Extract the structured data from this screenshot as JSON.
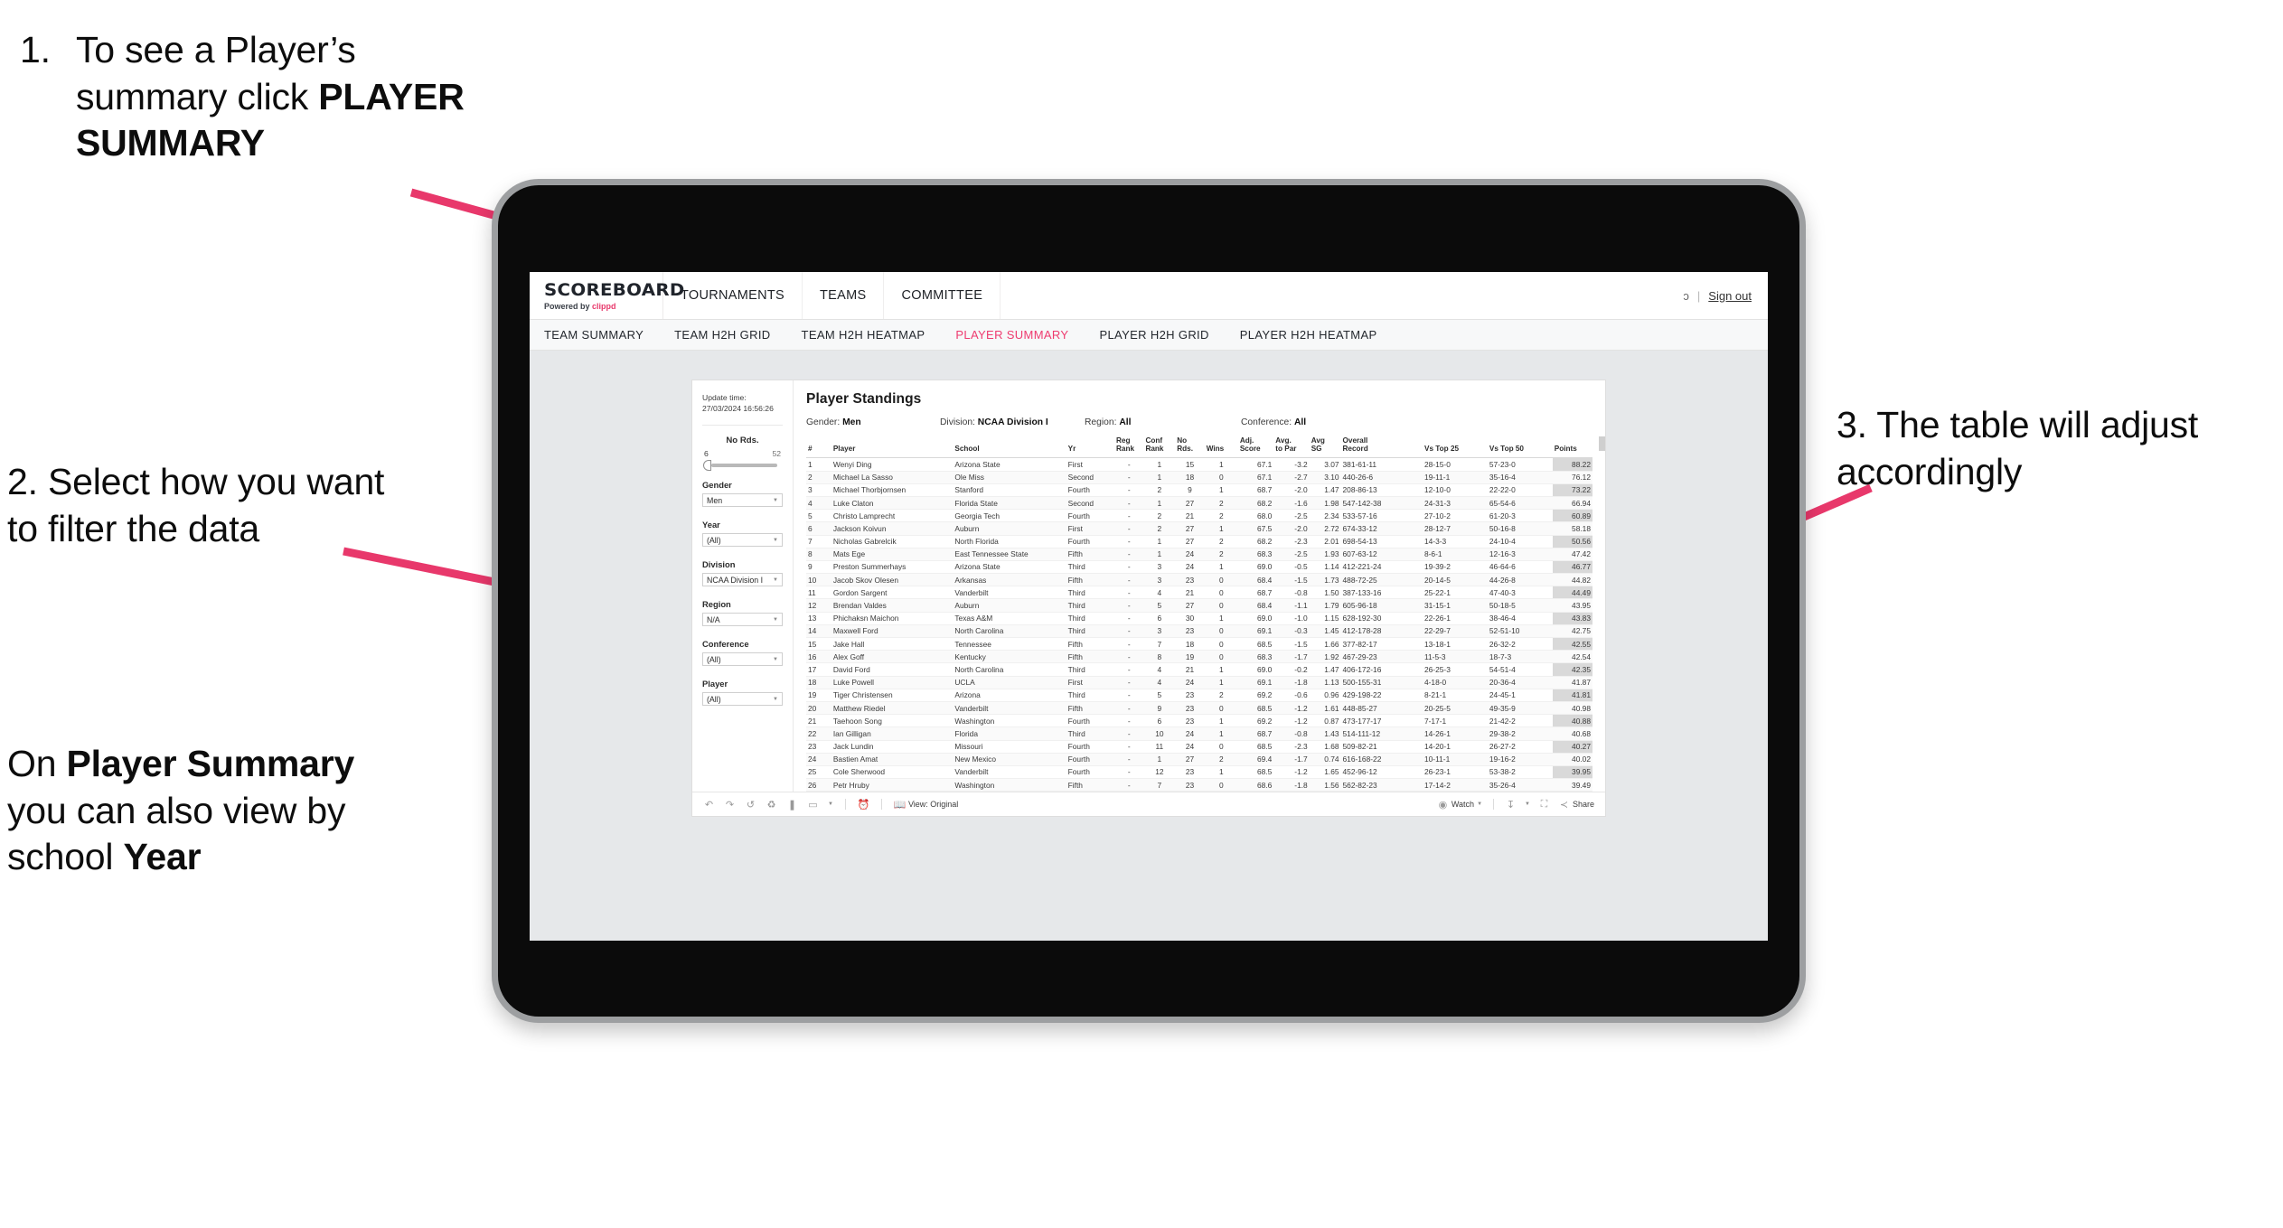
{
  "annotations": {
    "step1_number": "1.",
    "step1_text_a": "To see a Player’s summary click ",
    "step1_bold": "PLAYER SUMMARY",
    "step2": "2. Select how you want to filter the data",
    "step2b_pre": "On ",
    "step2b_bold1": "Player Summary",
    "step2b_mid": " you can also view by school ",
    "step2b_bold2": "Year",
    "step3": "3. The table will adjust accordingly",
    "arrow_color": "#e8386b"
  },
  "app": {
    "brand": {
      "name": "SCOREBOARD",
      "powered_prefix": "Powered by ",
      "powered_brand": "clippd"
    },
    "top_nav": [
      {
        "label": "TOURNAMENTS"
      },
      {
        "label": "TEAMS"
      },
      {
        "label": "COMMITTEE"
      }
    ],
    "top_right": {
      "account": "ɔ",
      "separator": "|",
      "sign_out": "Sign out"
    },
    "sub_nav": [
      {
        "label": "TEAM SUMMARY",
        "active": false
      },
      {
        "label": "TEAM H2H GRID",
        "active": false
      },
      {
        "label": "TEAM H2H HEATMAP",
        "active": false
      },
      {
        "label": "PLAYER SUMMARY",
        "active": true
      },
      {
        "label": "PLAYER H2H GRID",
        "active": false
      },
      {
        "label": "PLAYER H2H HEATMAP",
        "active": false
      }
    ],
    "accent_color": "#ee3b70"
  },
  "filters": {
    "update_time_label": "Update time:",
    "update_time_value": "27/03/2024 16:56:26",
    "slider": {
      "label": "No Rds.",
      "min": "6",
      "max": "52",
      "value": 6
    },
    "selects": [
      {
        "label": "Gender",
        "value": "Men"
      },
      {
        "label": "Year",
        "value": "(All)"
      },
      {
        "label": "Division",
        "value": "NCAA Division I"
      },
      {
        "label": "Region",
        "value": "N/A"
      },
      {
        "label": "Conference",
        "value": "(All)"
      },
      {
        "label": "Player",
        "value": "(All)"
      }
    ]
  },
  "viz": {
    "title": "Player Standings",
    "meta": [
      {
        "label": "Gender:",
        "value": "Men"
      },
      {
        "label": "Division:",
        "value": "NCAA Division I"
      },
      {
        "label": "Region:",
        "value": "All"
      },
      {
        "label": "Conference:",
        "value": "All"
      }
    ],
    "columns": [
      {
        "key": "rank",
        "l1": "#",
        "l2": ""
      },
      {
        "key": "player",
        "l1": "Player",
        "l2": ""
      },
      {
        "key": "school",
        "l1": "School",
        "l2": ""
      },
      {
        "key": "yr",
        "l1": "Yr",
        "l2": ""
      },
      {
        "key": "reg_rank",
        "l1": "Reg",
        "l2": "Rank"
      },
      {
        "key": "conf_rank",
        "l1": "Conf",
        "l2": "Rank"
      },
      {
        "key": "no_rds",
        "l1": "No",
        "l2": "Rds."
      },
      {
        "key": "wins",
        "l1": "Wins",
        "l2": ""
      },
      {
        "key": "adj_score",
        "l1": "Adj.",
        "l2": "Score"
      },
      {
        "key": "avg_to_par",
        "l1": "Avg.",
        "l2": "to Par"
      },
      {
        "key": "avg_sg",
        "l1": "Avg",
        "l2": "SG"
      },
      {
        "key": "overall_record",
        "l1": "Overall",
        "l2": "Record"
      },
      {
        "key": "vs_top25",
        "l1": "Vs Top 25",
        "l2": ""
      },
      {
        "key": "vs_top50",
        "l1": "Vs Top 50",
        "l2": ""
      },
      {
        "key": "points",
        "l1": "Points",
        "l2": ""
      }
    ],
    "rows": [
      {
        "rank": "1",
        "player": "Wenyi Ding",
        "school": "Arizona State",
        "yr": "First",
        "reg_rank": "-",
        "conf_rank": "1",
        "no_rds": "15",
        "wins": "1",
        "adj_score": "67.1",
        "avg_to_par": "-3.2",
        "avg_sg": "3.07",
        "overall_record": "381-61-11",
        "vs_top25": "28-15-0",
        "vs_top50": "57-23-0",
        "points": "88.22"
      },
      {
        "rank": "2",
        "player": "Michael La Sasso",
        "school": "Ole Miss",
        "yr": "Second",
        "reg_rank": "-",
        "conf_rank": "1",
        "no_rds": "18",
        "wins": "0",
        "adj_score": "67.1",
        "avg_to_par": "-2.7",
        "avg_sg": "3.10",
        "overall_record": "440-26-6",
        "vs_top25": "19-11-1",
        "vs_top50": "35-16-4",
        "points": "76.12"
      },
      {
        "rank": "3",
        "player": "Michael Thorbjornsen",
        "school": "Stanford",
        "yr": "Fourth",
        "reg_rank": "-",
        "conf_rank": "2",
        "no_rds": "9",
        "wins": "1",
        "adj_score": "68.7",
        "avg_to_par": "-2.0",
        "avg_sg": "1.47",
        "overall_record": "208-86-13",
        "vs_top25": "12-10-0",
        "vs_top50": "22-22-0",
        "points": "73.22"
      },
      {
        "rank": "4",
        "player": "Luke Claton",
        "school": "Florida State",
        "yr": "Second",
        "reg_rank": "-",
        "conf_rank": "1",
        "no_rds": "27",
        "wins": "2",
        "adj_score": "68.2",
        "avg_to_par": "-1.6",
        "avg_sg": "1.98",
        "overall_record": "547-142-38",
        "vs_top25": "24-31-3",
        "vs_top50": "65-54-6",
        "points": "66.94"
      },
      {
        "rank": "5",
        "player": "Christo Lamprecht",
        "school": "Georgia Tech",
        "yr": "Fourth",
        "reg_rank": "-",
        "conf_rank": "2",
        "no_rds": "21",
        "wins": "2",
        "adj_score": "68.0",
        "avg_to_par": "-2.5",
        "avg_sg": "2.34",
        "overall_record": "533-57-16",
        "vs_top25": "27-10-2",
        "vs_top50": "61-20-3",
        "points": "60.89"
      },
      {
        "rank": "6",
        "player": "Jackson Koivun",
        "school": "Auburn",
        "yr": "First",
        "reg_rank": "-",
        "conf_rank": "2",
        "no_rds": "27",
        "wins": "1",
        "adj_score": "67.5",
        "avg_to_par": "-2.0",
        "avg_sg": "2.72",
        "overall_record": "674-33-12",
        "vs_top25": "28-12-7",
        "vs_top50": "50-16-8",
        "points": "58.18"
      },
      {
        "rank": "7",
        "player": "Nicholas Gabrelcik",
        "school": "North Florida",
        "yr": "Fourth",
        "reg_rank": "-",
        "conf_rank": "1",
        "no_rds": "27",
        "wins": "2",
        "adj_score": "68.2",
        "avg_to_par": "-2.3",
        "avg_sg": "2.01",
        "overall_record": "698-54-13",
        "vs_top25": "14-3-3",
        "vs_top50": "24-10-4",
        "points": "50.56"
      },
      {
        "rank": "8",
        "player": "Mats Ege",
        "school": "East Tennessee State",
        "yr": "Fifth",
        "reg_rank": "-",
        "conf_rank": "1",
        "no_rds": "24",
        "wins": "2",
        "adj_score": "68.3",
        "avg_to_par": "-2.5",
        "avg_sg": "1.93",
        "overall_record": "607-63-12",
        "vs_top25": "8-6-1",
        "vs_top50": "12-16-3",
        "points": "47.42"
      },
      {
        "rank": "9",
        "player": "Preston Summerhays",
        "school": "Arizona State",
        "yr": "Third",
        "reg_rank": "-",
        "conf_rank": "3",
        "no_rds": "24",
        "wins": "1",
        "adj_score": "69.0",
        "avg_to_par": "-0.5",
        "avg_sg": "1.14",
        "overall_record": "412-221-24",
        "vs_top25": "19-39-2",
        "vs_top50": "46-64-6",
        "points": "46.77"
      },
      {
        "rank": "10",
        "player": "Jacob Skov Olesen",
        "school": "Arkansas",
        "yr": "Fifth",
        "reg_rank": "-",
        "conf_rank": "3",
        "no_rds": "23",
        "wins": "0",
        "adj_score": "68.4",
        "avg_to_par": "-1.5",
        "avg_sg": "1.73",
        "overall_record": "488-72-25",
        "vs_top25": "20-14-5",
        "vs_top50": "44-26-8",
        "points": "44.82"
      },
      {
        "rank": "11",
        "player": "Gordon Sargent",
        "school": "Vanderbilt",
        "yr": "Third",
        "reg_rank": "-",
        "conf_rank": "4",
        "no_rds": "21",
        "wins": "0",
        "adj_score": "68.7",
        "avg_to_par": "-0.8",
        "avg_sg": "1.50",
        "overall_record": "387-133-16",
        "vs_top25": "25-22-1",
        "vs_top50": "47-40-3",
        "points": "44.49"
      },
      {
        "rank": "12",
        "player": "Brendan Valdes",
        "school": "Auburn",
        "yr": "Third",
        "reg_rank": "-",
        "conf_rank": "5",
        "no_rds": "27",
        "wins": "0",
        "adj_score": "68.4",
        "avg_to_par": "-1.1",
        "avg_sg": "1.79",
        "overall_record": "605-96-18",
        "vs_top25": "31-15-1",
        "vs_top50": "50-18-5",
        "points": "43.95"
      },
      {
        "rank": "13",
        "player": "Phichaksn Maichon",
        "school": "Texas A&M",
        "yr": "Third",
        "reg_rank": "-",
        "conf_rank": "6",
        "no_rds": "30",
        "wins": "1",
        "adj_score": "69.0",
        "avg_to_par": "-1.0",
        "avg_sg": "1.15",
        "overall_record": "628-192-30",
        "vs_top25": "22-26-1",
        "vs_top50": "38-46-4",
        "points": "43.83"
      },
      {
        "rank": "14",
        "player": "Maxwell Ford",
        "school": "North Carolina",
        "yr": "Third",
        "reg_rank": "-",
        "conf_rank": "3",
        "no_rds": "23",
        "wins": "0",
        "adj_score": "69.1",
        "avg_to_par": "-0.3",
        "avg_sg": "1.45",
        "overall_record": "412-178-28",
        "vs_top25": "22-29-7",
        "vs_top50": "52-51-10",
        "points": "42.75"
      },
      {
        "rank": "15",
        "player": "Jake Hall",
        "school": "Tennessee",
        "yr": "Fifth",
        "reg_rank": "-",
        "conf_rank": "7",
        "no_rds": "18",
        "wins": "0",
        "adj_score": "68.5",
        "avg_to_par": "-1.5",
        "avg_sg": "1.66",
        "overall_record": "377-82-17",
        "vs_top25": "13-18-1",
        "vs_top50": "26-32-2",
        "points": "42.55"
      },
      {
        "rank": "16",
        "player": "Alex Goff",
        "school": "Kentucky",
        "yr": "Fifth",
        "reg_rank": "-",
        "conf_rank": "8",
        "no_rds": "19",
        "wins": "0",
        "adj_score": "68.3",
        "avg_to_par": "-1.7",
        "avg_sg": "1.92",
        "overall_record": "467-29-23",
        "vs_top25": "11-5-3",
        "vs_top50": "18-7-3",
        "points": "42.54"
      },
      {
        "rank": "17",
        "player": "David Ford",
        "school": "North Carolina",
        "yr": "Third",
        "reg_rank": "-",
        "conf_rank": "4",
        "no_rds": "21",
        "wins": "1",
        "adj_score": "69.0",
        "avg_to_par": "-0.2",
        "avg_sg": "1.47",
        "overall_record": "406-172-16",
        "vs_top25": "26-25-3",
        "vs_top50": "54-51-4",
        "points": "42.35"
      },
      {
        "rank": "18",
        "player": "Luke Powell",
        "school": "UCLA",
        "yr": "First",
        "reg_rank": "-",
        "conf_rank": "4",
        "no_rds": "24",
        "wins": "1",
        "adj_score": "69.1",
        "avg_to_par": "-1.8",
        "avg_sg": "1.13",
        "overall_record": "500-155-31",
        "vs_top25": "4-18-0",
        "vs_top50": "20-36-4",
        "points": "41.87"
      },
      {
        "rank": "19",
        "player": "Tiger Christensen",
        "school": "Arizona",
        "yr": "Third",
        "reg_rank": "-",
        "conf_rank": "5",
        "no_rds": "23",
        "wins": "2",
        "adj_score": "69.2",
        "avg_to_par": "-0.6",
        "avg_sg": "0.96",
        "overall_record": "429-198-22",
        "vs_top25": "8-21-1",
        "vs_top50": "24-45-1",
        "points": "41.81"
      },
      {
        "rank": "20",
        "player": "Matthew Riedel",
        "school": "Vanderbilt",
        "yr": "Fifth",
        "reg_rank": "-",
        "conf_rank": "9",
        "no_rds": "23",
        "wins": "0",
        "adj_score": "68.5",
        "avg_to_par": "-1.2",
        "avg_sg": "1.61",
        "overall_record": "448-85-27",
        "vs_top25": "20-25-5",
        "vs_top50": "49-35-9",
        "points": "40.98"
      },
      {
        "rank": "21",
        "player": "Taehoon Song",
        "school": "Washington",
        "yr": "Fourth",
        "reg_rank": "-",
        "conf_rank": "6",
        "no_rds": "23",
        "wins": "1",
        "adj_score": "69.2",
        "avg_to_par": "-1.2",
        "avg_sg": "0.87",
        "overall_record": "473-177-17",
        "vs_top25": "7-17-1",
        "vs_top50": "21-42-2",
        "points": "40.88"
      },
      {
        "rank": "22",
        "player": "Ian Gilligan",
        "school": "Florida",
        "yr": "Third",
        "reg_rank": "-",
        "conf_rank": "10",
        "no_rds": "24",
        "wins": "1",
        "adj_score": "68.7",
        "avg_to_par": "-0.8",
        "avg_sg": "1.43",
        "overall_record": "514-111-12",
        "vs_top25": "14-26-1",
        "vs_top50": "29-38-2",
        "points": "40.68"
      },
      {
        "rank": "23",
        "player": "Jack Lundin",
        "school": "Missouri",
        "yr": "Fourth",
        "reg_rank": "-",
        "conf_rank": "11",
        "no_rds": "24",
        "wins": "0",
        "adj_score": "68.5",
        "avg_to_par": "-2.3",
        "avg_sg": "1.68",
        "overall_record": "509-82-21",
        "vs_top25": "14-20-1",
        "vs_top50": "26-27-2",
        "points": "40.27"
      },
      {
        "rank": "24",
        "player": "Bastien Amat",
        "school": "New Mexico",
        "yr": "Fourth",
        "reg_rank": "-",
        "conf_rank": "1",
        "no_rds": "27",
        "wins": "2",
        "adj_score": "69.4",
        "avg_to_par": "-1.7",
        "avg_sg": "0.74",
        "overall_record": "616-168-22",
        "vs_top25": "10-11-1",
        "vs_top50": "19-16-2",
        "points": "40.02"
      },
      {
        "rank": "25",
        "player": "Cole Sherwood",
        "school": "Vanderbilt",
        "yr": "Fourth",
        "reg_rank": "-",
        "conf_rank": "12",
        "no_rds": "23",
        "wins": "1",
        "adj_score": "68.5",
        "avg_to_par": "-1.2",
        "avg_sg": "1.65",
        "overall_record": "452-96-12",
        "vs_top25": "26-23-1",
        "vs_top50": "53-38-2",
        "points": "39.95"
      },
      {
        "rank": "26",
        "player": "Petr Hruby",
        "school": "Washington",
        "yr": "Fifth",
        "reg_rank": "-",
        "conf_rank": "7",
        "no_rds": "23",
        "wins": "0",
        "adj_score": "68.6",
        "avg_to_par": "-1.8",
        "avg_sg": "1.56",
        "overall_record": "562-82-23",
        "vs_top25": "17-14-2",
        "vs_top50": "35-26-4",
        "points": "39.49"
      }
    ],
    "toolbar": {
      "undo": "undo-icon",
      "redo": "redo-icon",
      "revert": "revert-icon",
      "refresh": "refresh-icon",
      "pause": "pause-icon",
      "alerts": "alerts-icon",
      "view_label": "View: Original",
      "watch_label": "Watch",
      "share_label": "Share"
    }
  }
}
